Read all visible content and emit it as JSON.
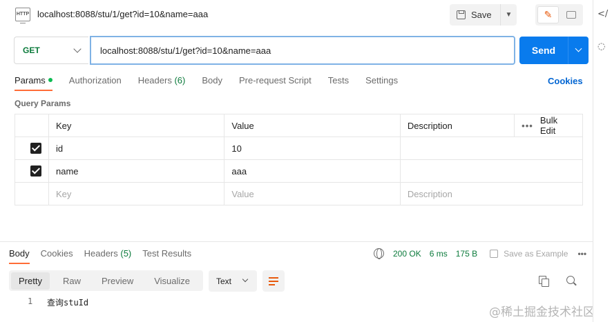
{
  "request": {
    "title": "localhost:8088/stu/1/get?id=10&name=aaa",
    "save_label": "Save",
    "method": "GET",
    "url": "localhost:8088/stu/1/get?id=10&name=aaa",
    "send_label": "Send"
  },
  "request_tabs": {
    "params": "Params",
    "authorization": "Authorization",
    "headers": "Headers",
    "headers_count": "(6)",
    "body": "Body",
    "prerequest": "Pre-request Script",
    "tests": "Tests",
    "settings": "Settings",
    "cookies": "Cookies"
  },
  "query_params": {
    "label": "Query Params",
    "headers": {
      "key": "Key",
      "value": "Value",
      "description": "Description",
      "bulk_edit": "Bulk Edit"
    },
    "rows": [
      {
        "key": "id",
        "value": "10",
        "checked": true
      },
      {
        "key": "name",
        "value": "aaa",
        "checked": true
      }
    ],
    "placeholder": {
      "key": "Key",
      "value": "Value",
      "description": "Description"
    }
  },
  "response": {
    "tabs": {
      "body": "Body",
      "cookies": "Cookies",
      "headers": "Headers",
      "headers_count": "(5)",
      "test_results": "Test Results"
    },
    "status": "200 OK",
    "time": "6 ms",
    "size": "175 B",
    "save_example": "Save as Example",
    "views": {
      "pretty": "Pretty",
      "raw": "Raw",
      "preview": "Preview",
      "visualize": "Visualize"
    },
    "format": "Text",
    "lines": [
      {
        "no": "1",
        "text": "查询stuId"
      }
    ]
  },
  "watermark": "@稀土掘金技术社区",
  "rail": {
    "code_icon_glyph": "</",
    "bulb_icon_glyph": "◌"
  }
}
